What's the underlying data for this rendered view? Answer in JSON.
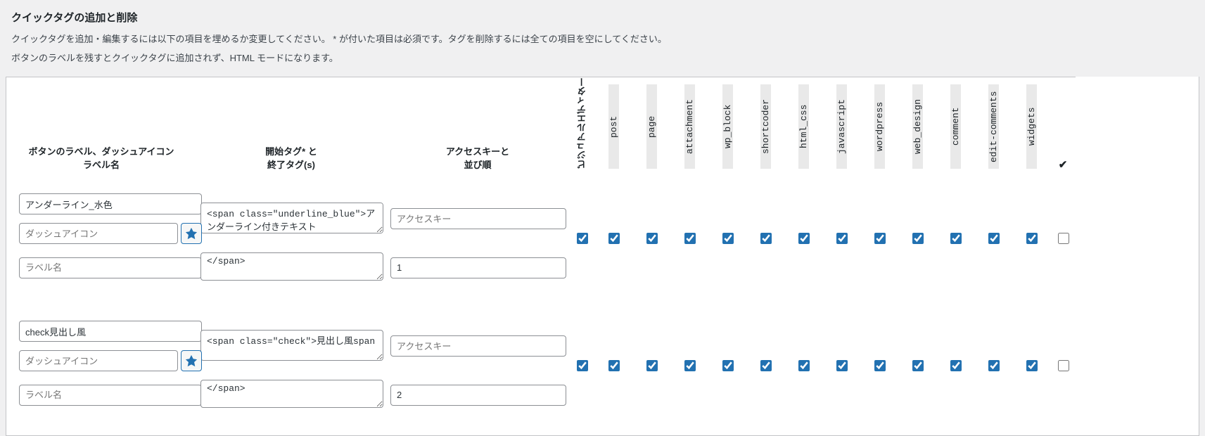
{
  "page": {
    "title": "クイックタグの追加と削除",
    "desc1": "クイックタグを追加・編集するには以下の項目を埋めるか変更してください。 * が付いた項目は必須です。タグを削除するには全ての項目を空にしてください。",
    "desc2": "ボタンのラベルを残すとクイックタグに追加されず、HTML モードになります。"
  },
  "headers": {
    "label": "ボタンのラベル、ダッシュアイコン\nラベル名",
    "tags": "開始タグ* と\n終了タグ(s)",
    "access": "アクセスキーと\n並び順",
    "visual_editor": "ビジュアルエディター",
    "check_all": "✔"
  },
  "post_types": [
    "post",
    "page",
    "attachment",
    "wp_block",
    "shortcoder",
    "html_css",
    "javascript",
    "wordpress",
    "web_design",
    "comment",
    "edit-comments",
    "widgets"
  ],
  "placeholders": {
    "dashicon": "ダッシュアイコン",
    "label_name": "ラベル名",
    "access_key": "アクセスキー"
  },
  "rows": [
    {
      "button_label": "アンダーライン_水色",
      "dashicon": "",
      "label_name": "",
      "open_tag": "<span class=\"underline_blue\">アンダーライン付きテキスト",
      "close_tag": "</span>",
      "access_key": "",
      "order": "1",
      "visual_editor": true,
      "types_checked": [
        true,
        true,
        true,
        true,
        true,
        true,
        true,
        true,
        true,
        true,
        true,
        true
      ],
      "all_checked": false
    },
    {
      "button_label": "check見出し風",
      "dashicon": "",
      "label_name": "",
      "open_tag": "<span class=\"check\">見出し風span",
      "close_tag": "</span>",
      "access_key": "",
      "order": "2",
      "visual_editor": true,
      "types_checked": [
        true,
        true,
        true,
        true,
        true,
        true,
        true,
        true,
        true,
        true,
        true,
        true
      ],
      "all_checked": false
    }
  ]
}
